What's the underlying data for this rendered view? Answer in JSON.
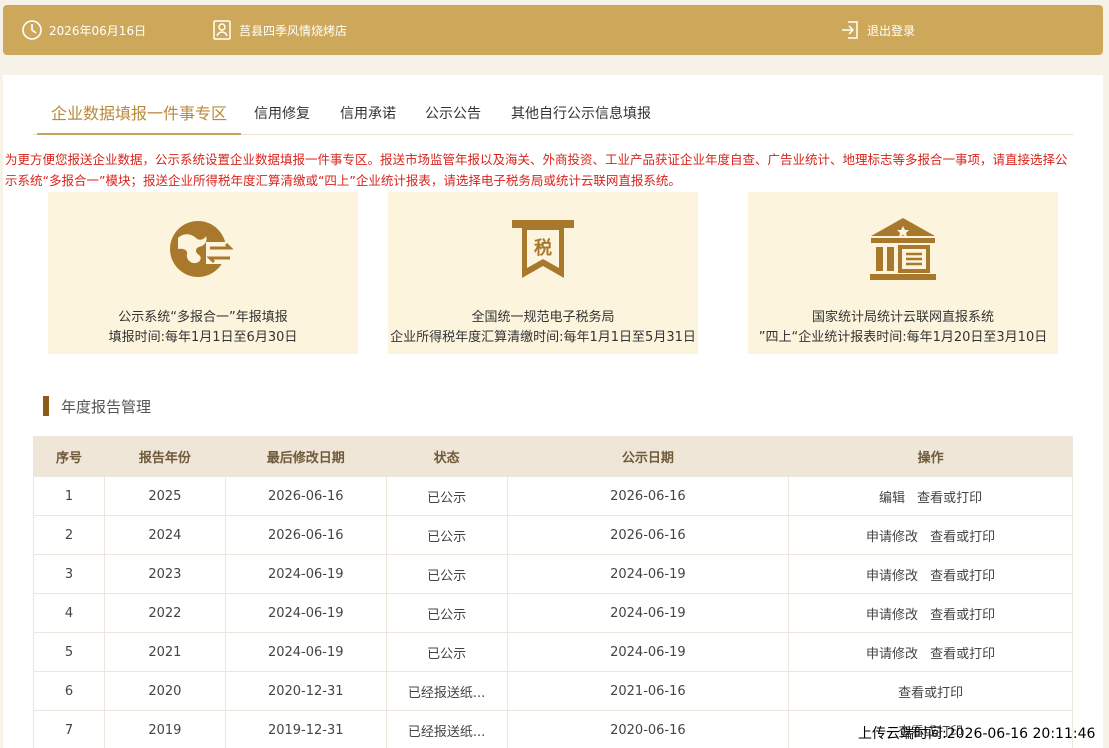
{
  "topbar": {
    "date": "2026年06月16日",
    "store_name": "莒县四季风情烧烤店",
    "logout_label": "退出登录",
    "background_color": "#cea85a"
  },
  "tabs": [
    {
      "label": "企业数据填报一件事专区",
      "active": true
    },
    {
      "label": "信用修复",
      "active": false
    },
    {
      "label": "信用承诺",
      "active": false
    },
    {
      "label": "公示公告",
      "active": false
    },
    {
      "label": "其他自行公示信息填报",
      "active": false
    }
  ],
  "notice": "为更方便您报送企业数据，公示系统设置企业数据填报一件事专区。报送市场监管年报以及海关、外商投资、工业产品获证企业年度自查、广告业统计、地理标志等多报合一事项，请直接选择公示系统“多报合一”模块；报送企业所得税年度汇算清缴或“四上”企业统计报表，请选择电子税务局或统计云联网直报系统。",
  "systems": [
    {
      "icon": "globe-report-icon",
      "title": "公示系统“多报合一”年报填报",
      "subtitle": "填报时间:每年1月1日至6月30日"
    },
    {
      "icon": "tax-icon",
      "icon_text": "税",
      "title": "全国统一规范电子税务局",
      "subtitle": "企业所得税年度汇算清缴时间:每年1月1日至5月31日"
    },
    {
      "icon": "government-building-icon",
      "title": "国家统计局统计云联网直报系统",
      "subtitle": "”四上“企业统计报表时间:每年1月20日至3月10日"
    }
  ],
  "section_title": "年度报告管理",
  "table": {
    "headers": [
      "序号",
      "报告年份",
      "最后修改日期",
      "状态",
      "公示日期",
      "操作"
    ],
    "rows": [
      {
        "no": "1",
        "year": "2025",
        "modified": "2026-06-16",
        "status": "已公示",
        "public_date": "2026-06-16",
        "actions": [
          "编辑",
          "查看或打印"
        ]
      },
      {
        "no": "2",
        "year": "2024",
        "modified": "2026-06-16",
        "status": "已公示",
        "public_date": "2026-06-16",
        "actions": [
          "申请修改",
          "查看或打印"
        ]
      },
      {
        "no": "3",
        "year": "2023",
        "modified": "2024-06-19",
        "status": "已公示",
        "public_date": "2024-06-19",
        "actions": [
          "申请修改",
          "查看或打印"
        ]
      },
      {
        "no": "4",
        "year": "2022",
        "modified": "2024-06-19",
        "status": "已公示",
        "public_date": "2024-06-19",
        "actions": [
          "申请修改",
          "查看或打印"
        ]
      },
      {
        "no": "5",
        "year": "2021",
        "modified": "2024-06-19",
        "status": "已公示",
        "public_date": "2024-06-19",
        "actions": [
          "申请修改",
          "查看或打印"
        ]
      },
      {
        "no": "6",
        "year": "2020",
        "modified": "2020-12-31",
        "status": "已经报送纸...",
        "public_date": "2021-06-16",
        "actions": [
          "查看或打印"
        ]
      },
      {
        "no": "7",
        "year": "2019",
        "modified": "2019-12-31",
        "status": "已经报送纸...",
        "public_date": "2020-06-16",
        "actions": [
          "查看或打印"
        ]
      }
    ]
  },
  "upload_timestamp": "上传云端时间:2026-06-16 20:11:46",
  "colors": {
    "accent": "#b88a3a",
    "notice": "#d9241c",
    "box_bg": "#fdf4de"
  }
}
